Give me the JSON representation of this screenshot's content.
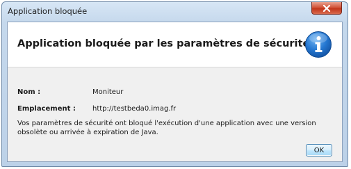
{
  "window": {
    "title": "Application bloquée"
  },
  "titlebar": {
    "close_icon": "close-x-icon",
    "close_color": "#c7432a"
  },
  "header": {
    "title": "Application bloquée par les paramètres de sécurité",
    "icon": "info-icon",
    "icon_color": "#1f6fc5"
  },
  "details": {
    "name_label": "Nom :",
    "name_value": "Moniteur",
    "location_label": "Emplacement :",
    "location_value": "http://testbeda0.imag.fr"
  },
  "message": "Vos paramètres de sécurité ont bloqué l'exécution d'une application avec une version obsolète ou arrivée à expiration de Java.",
  "buttons": {
    "ok_label": "OK"
  }
}
